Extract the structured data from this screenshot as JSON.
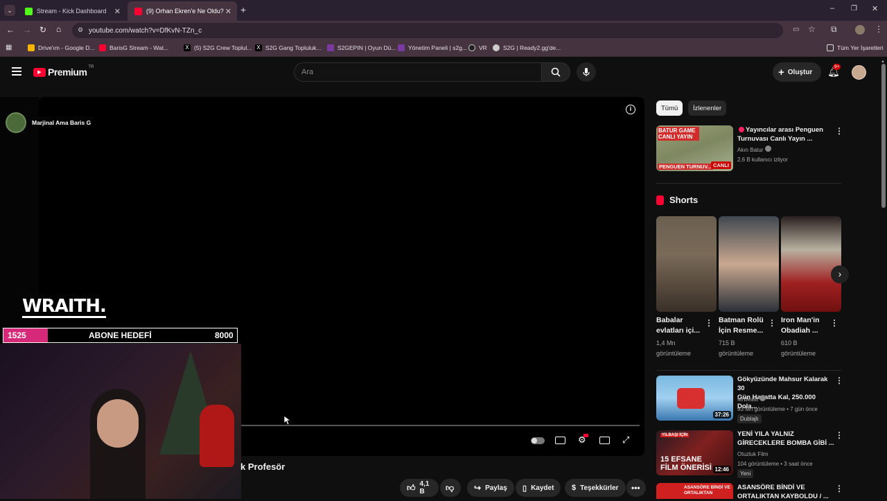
{
  "browser": {
    "tabs": [
      {
        "title": "Stream - Kick Dashboard",
        "active": false
      },
      {
        "title": "(9) Orhan Ekren'e Ne Oldu? İng",
        "active": true
      }
    ],
    "url": "youtube.com/watch?v=DfKvN-TZn_c",
    "bookmarks": [
      "Drive'ım - Google D...",
      "BarisG Stream - Wat...",
      "(5) S2G Crew Toplul...",
      "S2G Gang Topluluk...",
      "S2GEPIN | Oyun Dü...",
      "Yönetim Paneli | s2g...",
      "VR",
      "S2G | Ready2.gg'de..."
    ],
    "all_bookmarks": "Tüm Yer İşaretleri"
  },
  "youtube": {
    "logo": "Premium",
    "logo_region": "TR",
    "search_placeholder": "Ara",
    "create_label": "Oluştur",
    "notif_badge": "9+"
  },
  "stream": {
    "streamer_name": "Marjinal Ama Baris G",
    "brand": "WRAITH.",
    "goal": {
      "current": "1525",
      "label": "ABONE HEDEFİ",
      "target": "8000",
      "progress": 0.19
    }
  },
  "video": {
    "title_fragment": "k Profesör",
    "likes": "4,1 B",
    "share": "Paylaş",
    "save": "Kaydet",
    "thanks": "Teşekkürler"
  },
  "sidebar": {
    "chips": [
      "Tümü",
      "İzlenenler"
    ],
    "live": {
      "thumb_top": "BATUR GAME CANLI YAYIN",
      "thumb_bottom": "PENGUEN TURNUV...",
      "badge": "CANLI",
      "title_l1": "Yayıncılar arası Penguen",
      "title_l2": "Turnuvası  Canlı Yayın ...",
      "channel": "Akın Batur",
      "meta": "2,6 B kullanıcı izliyor"
    },
    "shorts_header": "Shorts",
    "shorts": [
      {
        "t1": "Babalar",
        "t2": "evlatları içi...",
        "views": "1,4 Mn",
        "unit": "görüntüleme"
      },
      {
        "t1": "Batman Rolü",
        "t2": "İçin Resme...",
        "views": "715 B",
        "unit": "görüntüleme"
      },
      {
        "t1": "Iron Man'in",
        "t2": "Obadiah ...",
        "views": "610 B",
        "unit": "görüntüleme"
      }
    ],
    "videos": [
      {
        "t1": "Gökyüzünde Mahsur Kalarak 30",
        "t2": "Gün Hayatta Kal, 250.000 Dola...",
        "channel": "MrBeast",
        "meta": "93 Mn görüntüleme • 7 gün önce",
        "badge": "Dublajlı",
        "duration": "37:26"
      },
      {
        "t1": "YENİ YILA YALNIZ",
        "t2": "GİRECEKLERE BOMBA GİBİ ...",
        "channel": "Otuzluk Film",
        "meta": "104 görüntüleme • 3 saat önce",
        "badge": "Yeni",
        "duration": "12:46",
        "thumb_text_l1": "15 EFSANE",
        "thumb_text_l2": "FİLM ÖNERİSİ",
        "thumb_tag": "YILBAŞI İÇİN"
      },
      {
        "t1": "ASANSÖRE BİNDİ VE",
        "t2": "ORTALIKTAN KAYBOLDU / ...",
        "thumb_text": "ASANSÖRE BİNDİ VE ORTALIKTAN"
      }
    ]
  },
  "colors": {
    "accent_red": "#ff0033",
    "goal_pink": "#d6297a",
    "kick_green": "#53fc18"
  }
}
